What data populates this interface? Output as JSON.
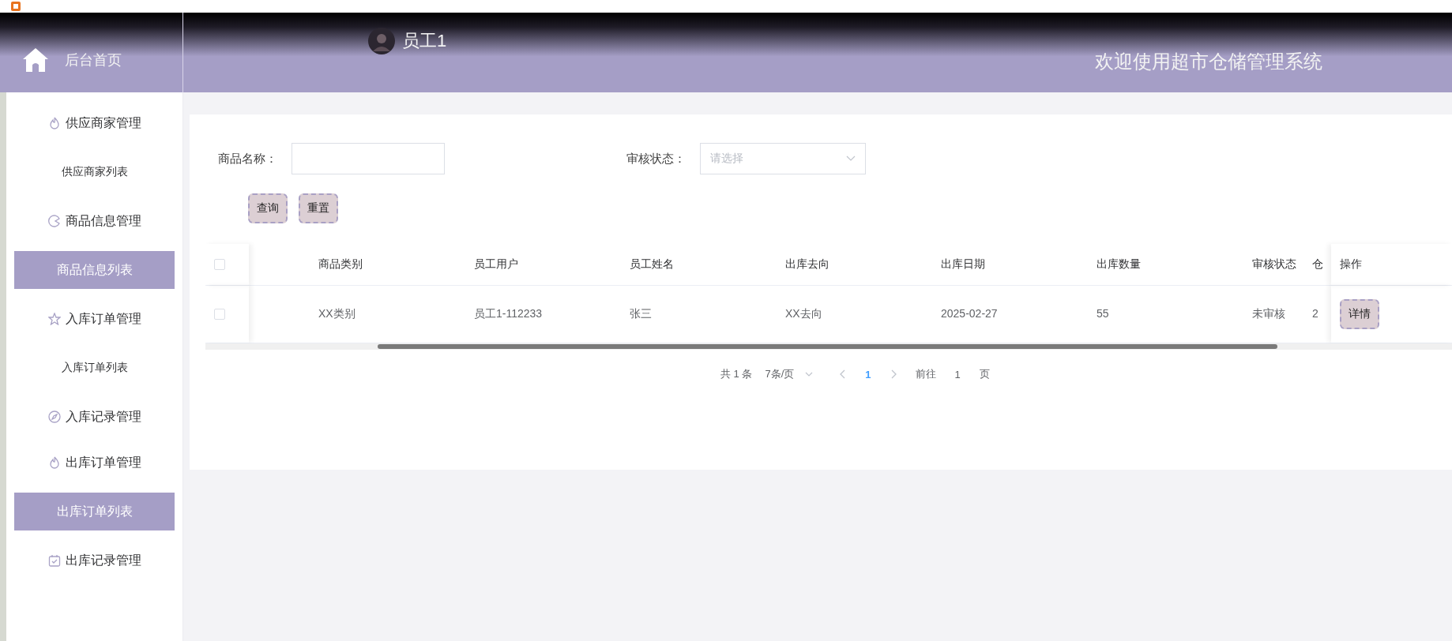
{
  "header": {
    "home_label": "后台首页",
    "user_name": "员工1",
    "welcome": "欢迎使用超市仓储管理系统"
  },
  "sidebar": {
    "items": [
      {
        "label": "供应商家管理",
        "kind": "group",
        "selected": false
      },
      {
        "label": "供应商家列表",
        "kind": "link",
        "selected": false
      },
      {
        "label": "商品信息管理",
        "kind": "group",
        "selected": false
      },
      {
        "label": "商品信息列表",
        "kind": "link",
        "selected": true
      },
      {
        "label": "入库订单管理",
        "kind": "group",
        "selected": false
      },
      {
        "label": "入库订单列表",
        "kind": "link",
        "selected": false
      },
      {
        "label": "入库记录管理",
        "kind": "group",
        "selected": false
      },
      {
        "label": "出库订单管理",
        "kind": "group",
        "selected": false
      },
      {
        "label": "出库订单列表",
        "kind": "link",
        "selected": true
      },
      {
        "label": "出库记录管理",
        "kind": "group",
        "selected": false
      }
    ]
  },
  "search": {
    "fields": [
      {
        "label": "商品名称：",
        "kind": "text"
      },
      {
        "label": "审核状态：",
        "kind": "select",
        "placeholder": "请选择"
      }
    ],
    "buttons": [
      "查询",
      "重置"
    ]
  },
  "table": {
    "header_checked": false,
    "columns": [
      "商品类别",
      "员工用户",
      "员工姓名",
      "出库去向",
      "出库日期",
      "出库数量",
      "审核状态",
      "仓"
    ],
    "action_column": "操作",
    "rows": [
      {
        "checked": false,
        "cells": [
          "XX类别",
          "员工1-112233",
          "张三",
          "XX去向",
          "2025-02-27",
          "55",
          "未审核",
          "2"
        ],
        "action": "详情"
      }
    ]
  },
  "pagination": {
    "total": "共 1 条",
    "page_size": "7条/页",
    "pages": [
      {
        "label": "1",
        "selected": true
      }
    ],
    "goto_label": "前往",
    "goto_value": "1",
    "goto_suffix": "页"
  }
}
